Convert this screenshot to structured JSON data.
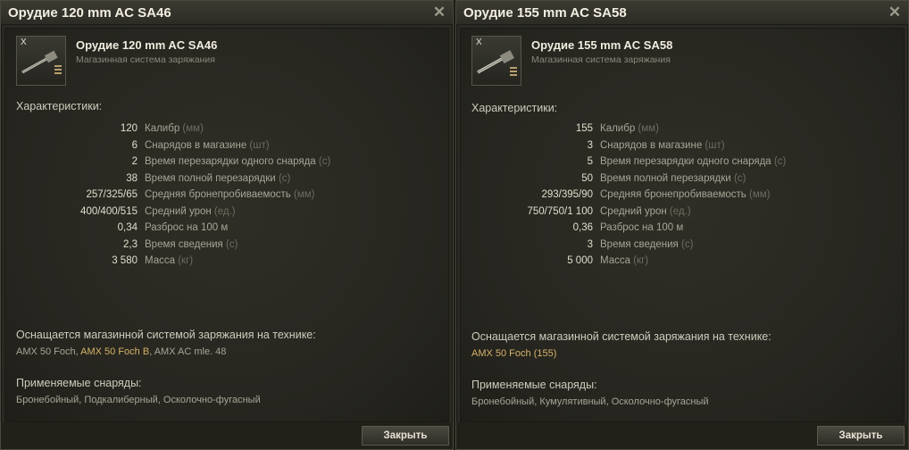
{
  "windows": [
    {
      "title": "Орудие 120 mm AC SA46",
      "tier": "X",
      "name": "Орудие 120 mm AC SA46",
      "subtitle": "Магазинная система заряжания",
      "characteristics_title": "Характеристики:",
      "stats": [
        {
          "value": "120",
          "label": "Калибр",
          "unit": "(мм)"
        },
        {
          "value": "6",
          "label": "Снарядов в магазине",
          "unit": "(шт)"
        },
        {
          "value": "2",
          "label": "Время перезарядки одного снаряда",
          "unit": "(с)"
        },
        {
          "value": "38",
          "label": "Время полной перезарядки",
          "unit": "(с)"
        },
        {
          "value": "257/325/65",
          "label": "Средняя бронепробиваемость",
          "unit": "(мм)"
        },
        {
          "value": "400/400/515",
          "label": "Средний урон",
          "unit": "(ед.)"
        },
        {
          "value": "0,34",
          "label": "Разброс на 100 м",
          "unit": ""
        },
        {
          "value": "2,3",
          "label": "Время сведения",
          "unit": "(с)"
        },
        {
          "value": "3 580",
          "label": "Масса",
          "unit": "(кг)"
        }
      ],
      "vehicles_title": "Оснащается магазинной системой заряжания на технике:",
      "vehicles": [
        {
          "name": "AMX 50 Foch",
          "premium": false
        },
        {
          "name": "AMX 50 Foch B",
          "premium": true
        },
        {
          "name": "AMX AC mle. 48",
          "premium": false
        }
      ],
      "ammo_title": "Применяемые снаряды:",
      "ammo": "Бронебойный, Подкалиберный, Осколочно-фугасный",
      "close_label": "Закрыть",
      "close_icon": "✕"
    },
    {
      "title": "Орудие 155 mm AC SA58",
      "tier": "X",
      "name": "Орудие 155 mm AC SA58",
      "subtitle": "Магазинная система заряжания",
      "characteristics_title": "Характеристики:",
      "stats": [
        {
          "value": "155",
          "label": "Калибр",
          "unit": "(мм)"
        },
        {
          "value": "3",
          "label": "Снарядов в магазине",
          "unit": "(шт)"
        },
        {
          "value": "5",
          "label": "Время перезарядки одного снаряда",
          "unit": "(с)"
        },
        {
          "value": "50",
          "label": "Время полной перезарядки",
          "unit": "(с)"
        },
        {
          "value": "293/395/90",
          "label": "Средняя бронепробиваемость",
          "unit": "(мм)"
        },
        {
          "value": "750/750/1 100",
          "label": "Средний урон",
          "unit": "(ед.)"
        },
        {
          "value": "0,36",
          "label": "Разброс на 100 м",
          "unit": ""
        },
        {
          "value": "3",
          "label": "Время сведения",
          "unit": "(с)"
        },
        {
          "value": "5 000",
          "label": "Масса",
          "unit": "(кг)"
        }
      ],
      "vehicles_title": "Оснащается магазинной системой заряжания на технике:",
      "vehicles": [
        {
          "name": "AMX 50 Foch (155)",
          "premium": true
        }
      ],
      "ammo_title": "Применяемые снаряды:",
      "ammo": "Бронебойный, Кумулятивный, Осколочно-фугасный",
      "close_label": "Закрыть",
      "close_icon": "✕"
    }
  ],
  "colors": {
    "premium_vehicle": "#d6b36a",
    "unit": "#6e6c62"
  }
}
